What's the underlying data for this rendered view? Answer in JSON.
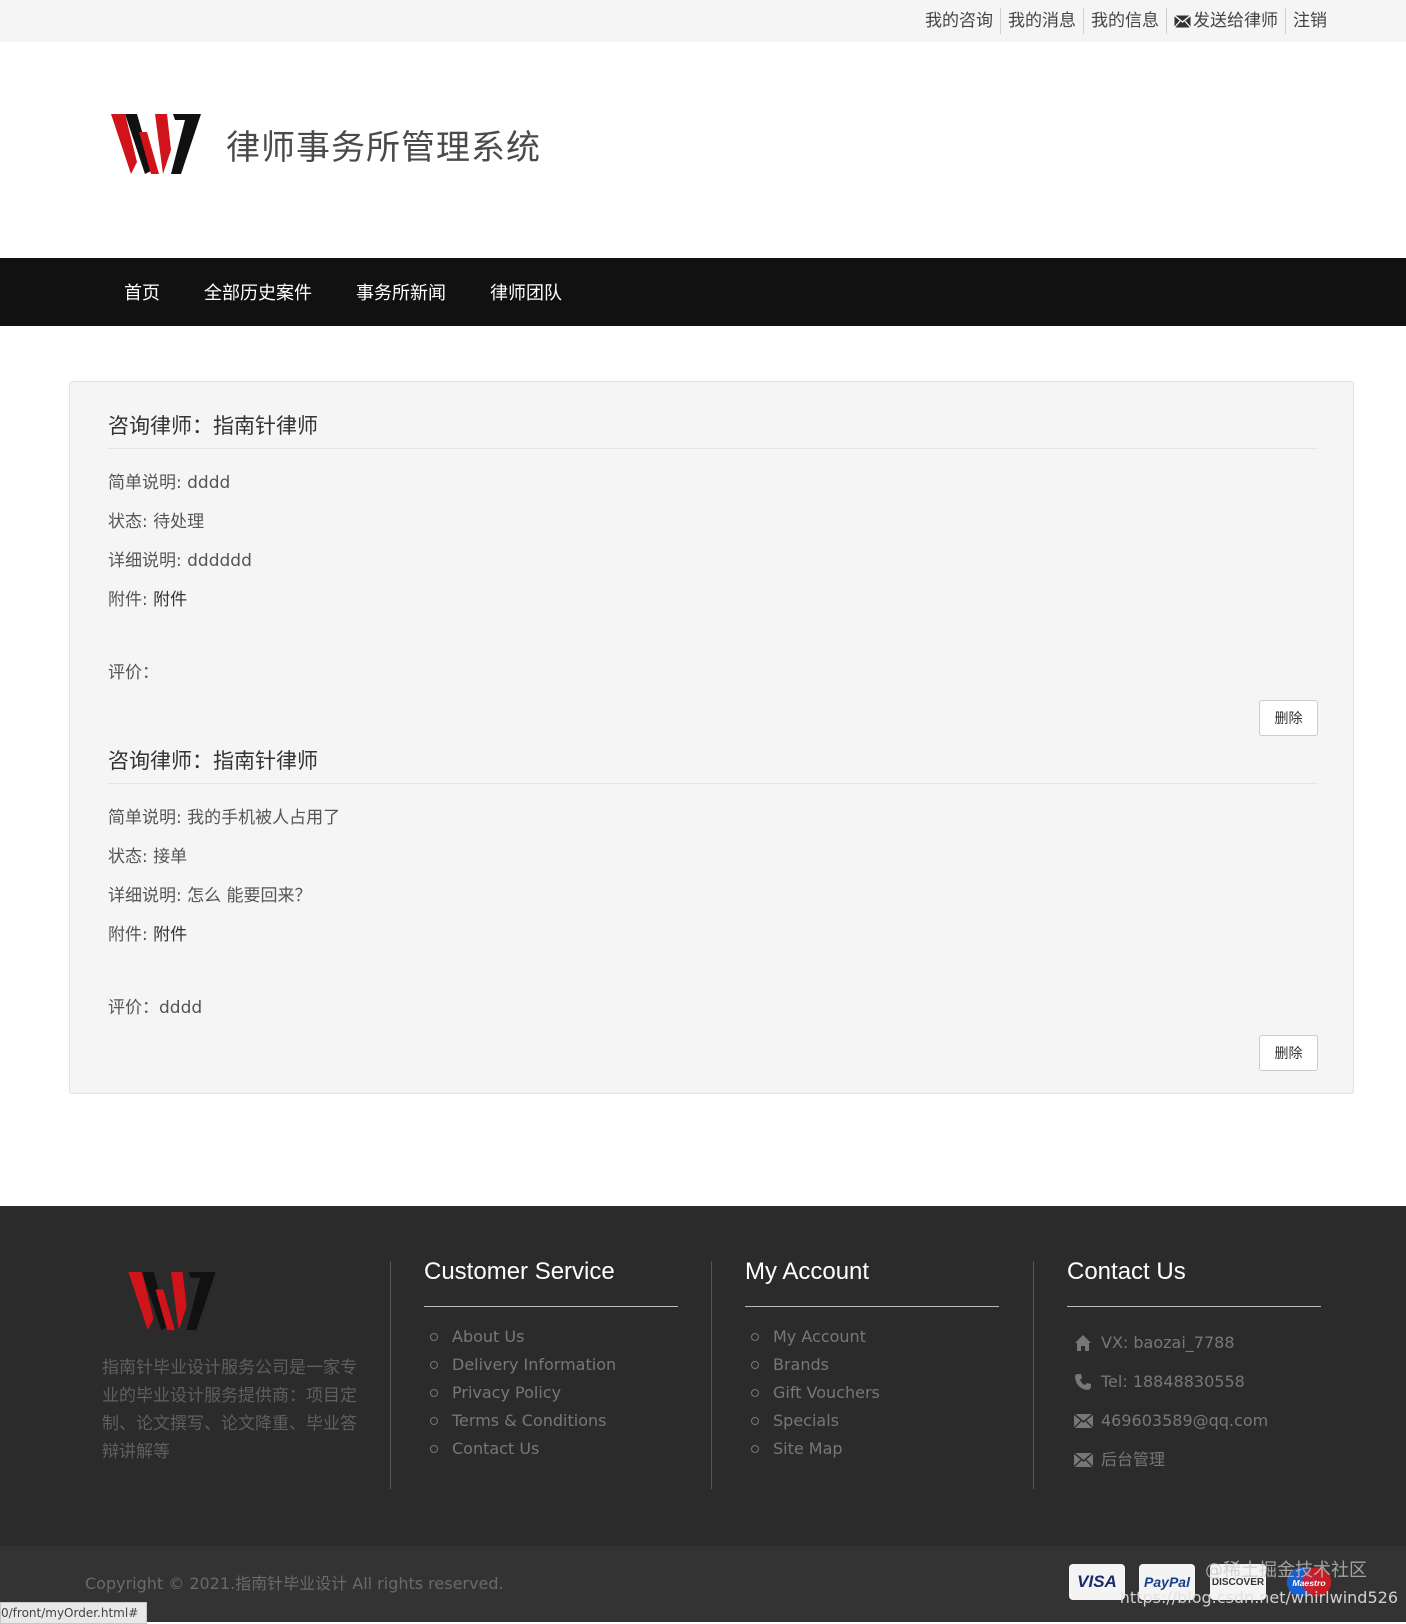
{
  "topnav": {
    "items": [
      "我的咨询",
      "我的消息",
      "我的信息",
      "发送给律师",
      "注销"
    ]
  },
  "header": {
    "site_title": "律师事务所管理系统"
  },
  "mainnav": {
    "items": [
      "首页",
      "全部历史案件",
      "事务所新闻",
      "律师团队"
    ]
  },
  "orders": [
    {
      "title": "咨询律师：指南针律师",
      "summary_label": "简单说明: ",
      "summary": "dddd",
      "status_label": "状态: ",
      "status": "待处理",
      "detail_label": "详细说明: ",
      "detail": "dddddd",
      "attachment_label": "附件: ",
      "attachment": "附件",
      "rating_label": "评价：",
      "rating": "",
      "delete_label": "删除"
    },
    {
      "title": "咨询律师：指南针律师",
      "summary_label": "简单说明: ",
      "summary": "我的手机被人占用了",
      "status_label": "状态: ",
      "status": "接单",
      "detail_label": "详细说明: ",
      "detail": "怎么 能要回来？",
      "attachment_label": "附件: ",
      "attachment": "附件",
      "rating_label": "评价：",
      "rating": "dddd",
      "delete_label": "删除"
    }
  ],
  "footer": {
    "about": "指南针毕业设计服务公司是一家专业的毕业设计服务提供商：项目定制、论文撰写、论文降重、毕业答辩讲解等",
    "customer_service": {
      "heading": "Customer Service",
      "links": [
        "About Us",
        "Delivery Information",
        "Privacy Policy",
        "Terms & Conditions",
        "Contact Us"
      ]
    },
    "my_account": {
      "heading": "My Account",
      "links": [
        "My Account",
        "Brands",
        "Gift Vouchers",
        "Specials",
        "Site Map"
      ]
    },
    "contact": {
      "heading": "Contact Us",
      "items": [
        {
          "icon": "home-icon",
          "text": "VX: baozai_7788"
        },
        {
          "icon": "phone-icon",
          "text": "Tel: 18848830558"
        },
        {
          "icon": "envelope-icon",
          "text": "469603589@qq.com"
        },
        {
          "icon": "envelope-icon",
          "text": "后台管理"
        }
      ]
    },
    "copyright": "Copyright © 2021.指南针毕业设计 All rights reserved.",
    "payment": [
      "VISA",
      "PayPal",
      "DISCOVER",
      "Maestro"
    ],
    "watermark": "@稀土掘金技术社区",
    "url_watermark": "https://blog.csdn.net/whirlwind526",
    "status_url": "0/front/myOrder.html#"
  },
  "colors": {
    "logo_red": "#d0141a",
    "logo_black": "#111111",
    "nav_bg": "#111111",
    "footer_bg": "#2b2b2b"
  }
}
